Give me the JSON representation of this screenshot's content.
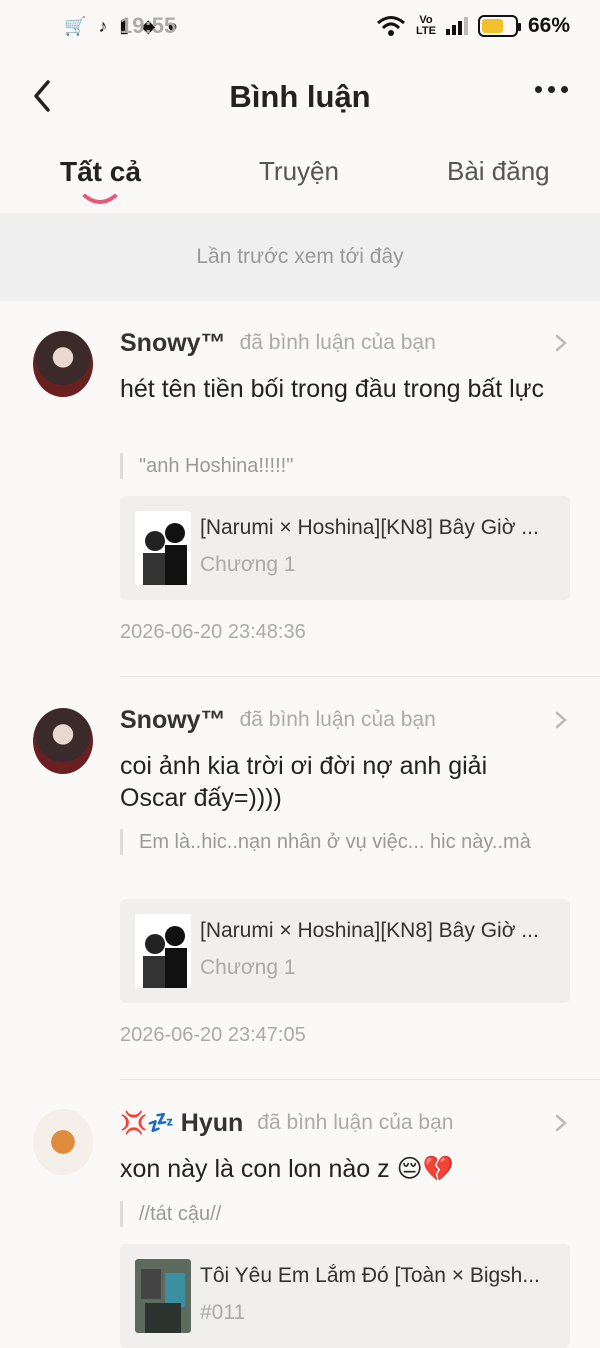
{
  "status_bar": {
    "time": "19:55",
    "battery": "66%",
    "battery_level": 0.66
  },
  "header": {
    "title": "Bình luận"
  },
  "tabs": [
    {
      "label": "Tất cả",
      "active": true
    },
    {
      "label": "Truyện",
      "active": false
    },
    {
      "label": "Bài đăng",
      "active": false
    }
  ],
  "notice": "Lần trước xem tới đây",
  "comments": [
    {
      "user": "Snowy™",
      "action": "đã bình luận của bạn",
      "text": "hét tên tiền bối trong đầu trong bất lực",
      "quote": "\"anh Hoshina!!!!!\"",
      "card_title": "[Narumi × Hoshina][KN8] Bây Giờ ...",
      "card_sub": "Chương 1",
      "time": "2026-06-20 23:48:36"
    },
    {
      "user": "Snowy™",
      "action": "đã bình luận của bạn",
      "text": "coi ảnh kia trời ơi đời nợ anh giải Oscar đấy=))))",
      "quote": "Em là..hic..nạn nhân ở vụ việc... hic này..mà",
      "card_title": "[Narumi × Hoshina][KN8] Bây Giờ ...",
      "card_sub": "Chương 1",
      "time": "2026-06-20 23:47:05"
    },
    {
      "user_prefix": "💢💤",
      "user": "Hyun",
      "action": "đã bình luận của bạn",
      "text": "xon này là con lon nào z 😔💔",
      "quote": "//tát cậu//",
      "card_title": "Tôi Yêu Em Lắm Đó [Toàn × Bigsh...",
      "card_sub": "#011"
    }
  ],
  "colors": {
    "accent": "#e8587a",
    "background": "#faf9f8",
    "notice_bg": "#efefef"
  }
}
